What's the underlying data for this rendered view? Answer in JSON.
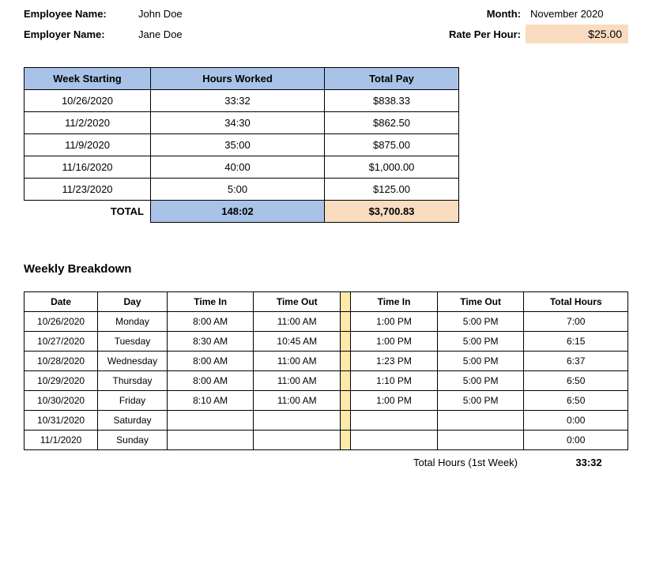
{
  "header": {
    "employee_label": "Employee Name:",
    "employee_value": "John Doe",
    "employer_label": "Employer Name:",
    "employer_value": "Jane Doe",
    "month_label": "Month:",
    "month_value": "November 2020",
    "rate_label": "Rate Per Hour:",
    "rate_value": "$25.00"
  },
  "summary": {
    "headers": {
      "week": "Week Starting",
      "hours": "Hours Worked",
      "pay": "Total Pay"
    },
    "rows": [
      {
        "week": "10/26/2020",
        "hours": "33:32",
        "pay": "$838.33"
      },
      {
        "week": "11/2/2020",
        "hours": "34:30",
        "pay": "$862.50"
      },
      {
        "week": "11/9/2020",
        "hours": "35:00",
        "pay": "$875.00"
      },
      {
        "week": "11/16/2020",
        "hours": "40:00",
        "pay": "$1,000.00"
      },
      {
        "week": "11/23/2020",
        "hours": "5:00",
        "pay": "$125.00"
      }
    ],
    "total_label": "TOTAL",
    "total_hours": "148:02",
    "total_pay": "$3,700.83"
  },
  "breakdown": {
    "title": "Weekly Breakdown",
    "headers": {
      "date": "Date",
      "day": "Day",
      "tin1": "Time In",
      "tout1": "Time Out",
      "tin2": "Time In",
      "tout2": "Time Out",
      "total": "Total Hours"
    },
    "rows": [
      {
        "date": "10/26/2020",
        "day": "Monday",
        "tin1": "8:00 AM",
        "tout1": "11:00 AM",
        "tin2": "1:00 PM",
        "tout2": "5:00 PM",
        "total": "7:00"
      },
      {
        "date": "10/27/2020",
        "day": "Tuesday",
        "tin1": "8:30 AM",
        "tout1": "10:45 AM",
        "tin2": "1:00 PM",
        "tout2": "5:00 PM",
        "total": "6:15"
      },
      {
        "date": "10/28/2020",
        "day": "Wednesday",
        "tin1": "8:00 AM",
        "tout1": "11:00 AM",
        "tin2": "1:23 PM",
        "tout2": "5:00 PM",
        "total": "6:37"
      },
      {
        "date": "10/29/2020",
        "day": "Thursday",
        "tin1": "8:00 AM",
        "tout1": "11:00 AM",
        "tin2": "1:10 PM",
        "tout2": "5:00 PM",
        "total": "6:50"
      },
      {
        "date": "10/30/2020",
        "day": "Friday",
        "tin1": "8:10 AM",
        "tout1": "11:00 AM",
        "tin2": "1:00 PM",
        "tout2": "5:00 PM",
        "total": "6:50"
      },
      {
        "date": "10/31/2020",
        "day": "Saturday",
        "tin1": "",
        "tout1": "",
        "tin2": "",
        "tout2": "",
        "total": "0:00"
      },
      {
        "date": "11/1/2020",
        "day": "Sunday",
        "tin1": "",
        "tout1": "",
        "tin2": "",
        "tout2": "",
        "total": "0:00"
      }
    ],
    "footer_label": "Total Hours (1st Week)",
    "footer_value": "33:32"
  }
}
